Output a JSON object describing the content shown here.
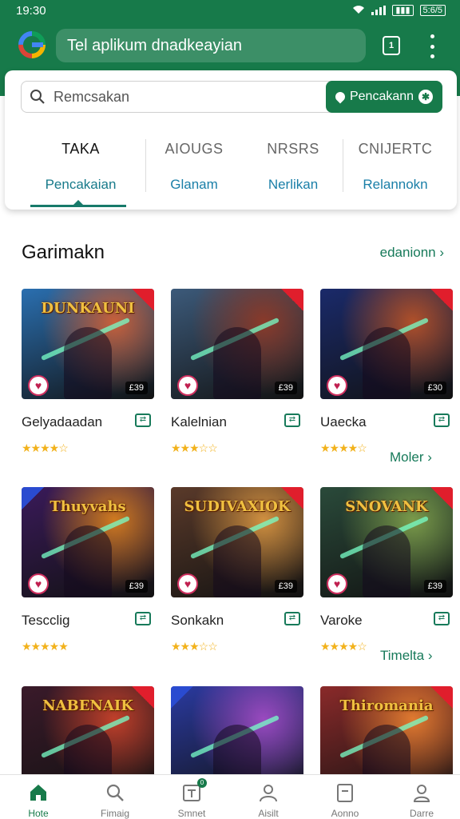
{
  "status": {
    "time": "19:30",
    "battery": "5:6/5"
  },
  "topbar": {
    "url": "Tel aplikum dnadkeayian"
  },
  "search": {
    "placeholder": "Remcsakan",
    "button_label": "Pencakann"
  },
  "categories": [
    {
      "title": "TAKA",
      "sub": "Pencakaian",
      "active": true
    },
    {
      "title": "AIOUGS",
      "sub": "Glanam",
      "active": false
    },
    {
      "title": "NRSRS",
      "sub": "Nerlikan",
      "active": false
    },
    {
      "title": "CNIJERTC",
      "sub": "Relannokn",
      "active": false
    }
  ],
  "section": {
    "title": "Garimakn",
    "see_all": "edanionn"
  },
  "games": [
    {
      "name": "Gelyadaadan",
      "price": "£39",
      "stars": "★★★★☆",
      "art": "DUNKAUNI",
      "colors": [
        "#2a6fb0",
        "#c8603a"
      ],
      "badge": "r"
    },
    {
      "name": "Kalelnian",
      "price": "£39",
      "stars": "★★★☆☆",
      "art": "",
      "colors": [
        "#3c5a7a",
        "#8a3a2a"
      ],
      "badge": "r"
    },
    {
      "name": "Uaecka",
      "price": "£30",
      "stars": "★★★★☆",
      "art": "",
      "colors": [
        "#1a2a6a",
        "#b0502a"
      ],
      "badge": "r"
    },
    {
      "name": "Tescclig",
      "price": "£39",
      "stars": "★★★★★",
      "art": "Thuyvahs",
      "colors": [
        "#3a1a5a",
        "#d07a20"
      ],
      "badge": "l"
    },
    {
      "name": "Sonkakn",
      "price": "£39",
      "stars": "★★★☆☆",
      "art": "SUDIVAXIOK",
      "colors": [
        "#5a3a2a",
        "#d09040"
      ],
      "badge": "r"
    },
    {
      "name": "Varoke",
      "price": "£39",
      "stars": "★★★★☆",
      "art": "SNOVANK",
      "colors": [
        "#2a4a3a",
        "#7a9a4a"
      ],
      "badge": "r"
    },
    {
      "name": "",
      "price": "",
      "stars": "",
      "art": "NABENAIK",
      "colors": [
        "#3a1a2a",
        "#c0402a"
      ],
      "badge": "r"
    },
    {
      "name": "",
      "price": "",
      "stars": "",
      "art": "",
      "colors": [
        "#2a3aa0",
        "#9a4ac0"
      ],
      "badge": "l"
    },
    {
      "name": "",
      "price": "",
      "stars": "",
      "art": "Thiromania",
      "colors": [
        "#8a2a2a",
        "#e07a30"
      ],
      "badge": "r"
    }
  ],
  "more_links": [
    "Moler",
    "Timelta"
  ],
  "nav": [
    {
      "label": "Hote",
      "icon": "home-icon",
      "active": true
    },
    {
      "label": "Fimaig",
      "icon": "search-icon",
      "active": false
    },
    {
      "label": "Smnet",
      "icon": "store-icon",
      "active": false,
      "badge": "0"
    },
    {
      "label": "Aisilt",
      "icon": "person-icon",
      "active": false
    },
    {
      "label": "Aonno",
      "icon": "library-icon",
      "active": false
    },
    {
      "label": "Darre",
      "icon": "account-icon",
      "active": false
    }
  ],
  "colors": {
    "primary": "#177a4a",
    "link": "#1a7fa8",
    "star": "#f2b21c"
  }
}
